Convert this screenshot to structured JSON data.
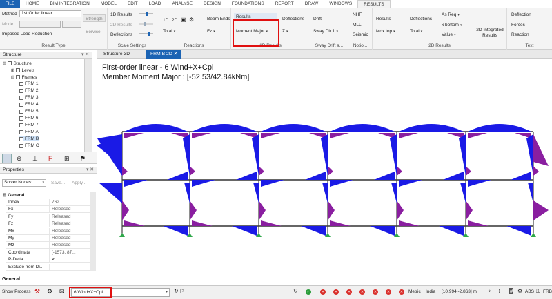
{
  "menu_tabs": [
    "FILE",
    "HOME",
    "BIM INTEGRATION",
    "MODEL",
    "EDIT",
    "LOAD",
    "ANALYSE",
    "DESIGN",
    "FOUNDATIONS",
    "REPORT",
    "DRAW",
    "WINDOWS",
    "RESULTS"
  ],
  "active_tab": "RESULTS",
  "ribbon": {
    "result_type": {
      "method_label": "Method",
      "method_value": "1st Order linear",
      "mode_label": "Mode",
      "imposed_label": "Imposed Load Reduction",
      "strength": "Strength",
      "service": "Service",
      "caption": "Result Type"
    },
    "scale": {
      "r1": "1D Results",
      "r2": "2D Results",
      "r3": "Deflections",
      "caption": "Scale Settings"
    },
    "reactions": {
      "d1": "1D",
      "d2": "2D",
      "total": "Total",
      "fz": "Fz",
      "beam_ends": "Beam Ends",
      "caption": "Reactions"
    },
    "results1d": {
      "results": "Results",
      "moment": "Moment Major",
      "deflections": "Deflections",
      "z": "Z",
      "caption": "1D Results"
    },
    "sway": {
      "drift": "Drift",
      "sway_dir": "Sway Dir 1",
      "caption": "Sway Drift a..."
    },
    "notional": {
      "nhf": "NHF",
      "mll": "MLL",
      "seismic": "Seismic",
      "caption": "Notio..."
    },
    "results2d": {
      "results": "Results",
      "mdx": "Mdx top",
      "deflections": "Deflections",
      "total": "Total",
      "as_req": "As Req",
      "x_bottom": "x bottom",
      "value": "Value",
      "integrated": "2D Integrated Results",
      "caption": "2D Results"
    },
    "text": {
      "deflection": "Deflection",
      "forces": "Forces",
      "reaction": "Reaction",
      "caption": "Text"
    }
  },
  "structure_panel": {
    "title": "Structure",
    "root": "Structure",
    "levels": "Levels",
    "frames": "Frames",
    "frames_list": [
      "FRM 1",
      "FRM 2",
      "FRM 3",
      "FRM 4",
      "FRM 5",
      "FRM 6",
      "FRM 7",
      "FRM A",
      "FRM B",
      "FRM C"
    ],
    "selected": "FRM B"
  },
  "properties_panel": {
    "title": "Properties",
    "selector": "Solver Nodes:",
    "save": "Save...",
    "apply": "Apply...",
    "section": "General",
    "rows": [
      {
        "k": "Index",
        "v": "762"
      },
      {
        "k": "Fx",
        "v": "Released"
      },
      {
        "k": "Fy",
        "v": "Released"
      },
      {
        "k": "Fz",
        "v": "Released"
      },
      {
        "k": "Mx",
        "v": "Released"
      },
      {
        "k": "My",
        "v": "Released"
      },
      {
        "k": "Mz",
        "v": "Released"
      },
      {
        "k": "Coordinate",
        "v": "[-1573, 87..."
      },
      {
        "k": "P-Delta",
        "v": "✔"
      },
      {
        "k": "Exclude from Di...",
        "v": ""
      }
    ],
    "footer": "General"
  },
  "doc_tabs": [
    "Structure 3D",
    "FRM B 2D"
  ],
  "active_doc": "FRM B 2D",
  "canvas": {
    "line1": "First-order linear - 6 Wind+X+Cpi",
    "line2": "Member Moment Major  : [-52.53/42.84kNm]"
  },
  "status": {
    "show_process": "Show Process",
    "combo": "6 Wind+X+Cpi",
    "metric": "Metric",
    "country": "India",
    "coord": "[10.994,-2.863] m",
    "abs": "ABS",
    "frb": "FRB"
  },
  "colors": {
    "accent": "#1c64b4",
    "highlight": "#e01010",
    "moment_blue": "#1a1ae6",
    "moment_purple": "#8a1ea0",
    "support": "#2fa84a"
  }
}
